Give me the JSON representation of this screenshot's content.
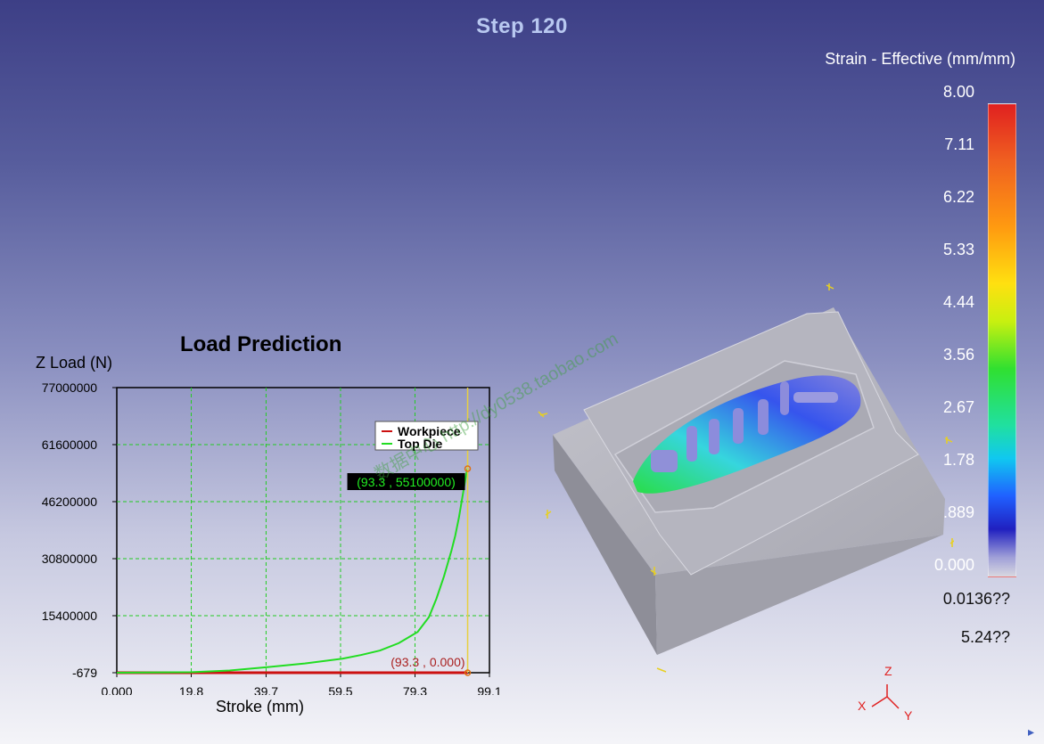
{
  "header": {
    "step_label": "Step  120"
  },
  "legend": {
    "title": "Strain - Effective (mm/mm)",
    "ticks": [
      "8.00",
      "7.11",
      "6.22",
      "5.33",
      "4.44",
      "3.56",
      "2.67",
      "1.78",
      "0.889",
      "0.000"
    ],
    "extra_values": [
      "0.0136??",
      "5.24??"
    ],
    "colors": [
      "#e02020",
      "#ff9a10",
      "#ffe010",
      "#30e030",
      "#10c8f0",
      "#2060ff",
      "#d8d8e0"
    ]
  },
  "watermark_text": "数据中心 http://dy0538.taobao.com",
  "triad": {
    "x": "X",
    "y": "Y",
    "z": "Z"
  },
  "chart_data": {
    "type": "line",
    "title": "Load Prediction",
    "xlabel": "Stroke (mm)",
    "ylabel": "Z Load (N)",
    "xlim": [
      0,
      99.1
    ],
    "ylim": [
      -679,
      77000000
    ],
    "x_ticks": [
      "0.000",
      "19.8",
      "39.7",
      "59.5",
      "79.3",
      "99.1"
    ],
    "y_ticks": [
      "77000000",
      "61600000",
      "46200000",
      "30800000",
      "15400000",
      "-679"
    ],
    "x_tick_values": [
      0,
      19.8,
      39.7,
      59.5,
      79.3,
      99.1
    ],
    "y_tick_values": [
      77000000,
      61600000,
      46200000,
      30800000,
      15400000,
      -679
    ],
    "grid": true,
    "legend_position": "top-right",
    "series": [
      {
        "name": "Workpiece",
        "color": "#cc1010",
        "x": [
          0,
          93.3
        ],
        "y": [
          0,
          0
        ]
      },
      {
        "name": "Top Die",
        "color": "#22dd22",
        "x": [
          0,
          20,
          30,
          40,
          50,
          60,
          65,
          70,
          75,
          80,
          83,
          85,
          87,
          89,
          90,
          91,
          92,
          93,
          93.3
        ],
        "y": [
          0,
          150000,
          600000,
          1500000,
          2500000,
          3800000,
          4800000,
          6000000,
          8000000,
          11000000,
          15000000,
          20000000,
          26000000,
          33000000,
          37000000,
          42000000,
          48000000,
          54000000,
          55100000
        ]
      }
    ],
    "annotations": [
      {
        "text": "(93.3 , 55100000)",
        "x": 93.3,
        "y": 55100000
      },
      {
        "text": "(93.3 , 0.000)",
        "x": 93.3,
        "y": 0
      }
    ],
    "cursor_x": 93.3
  }
}
